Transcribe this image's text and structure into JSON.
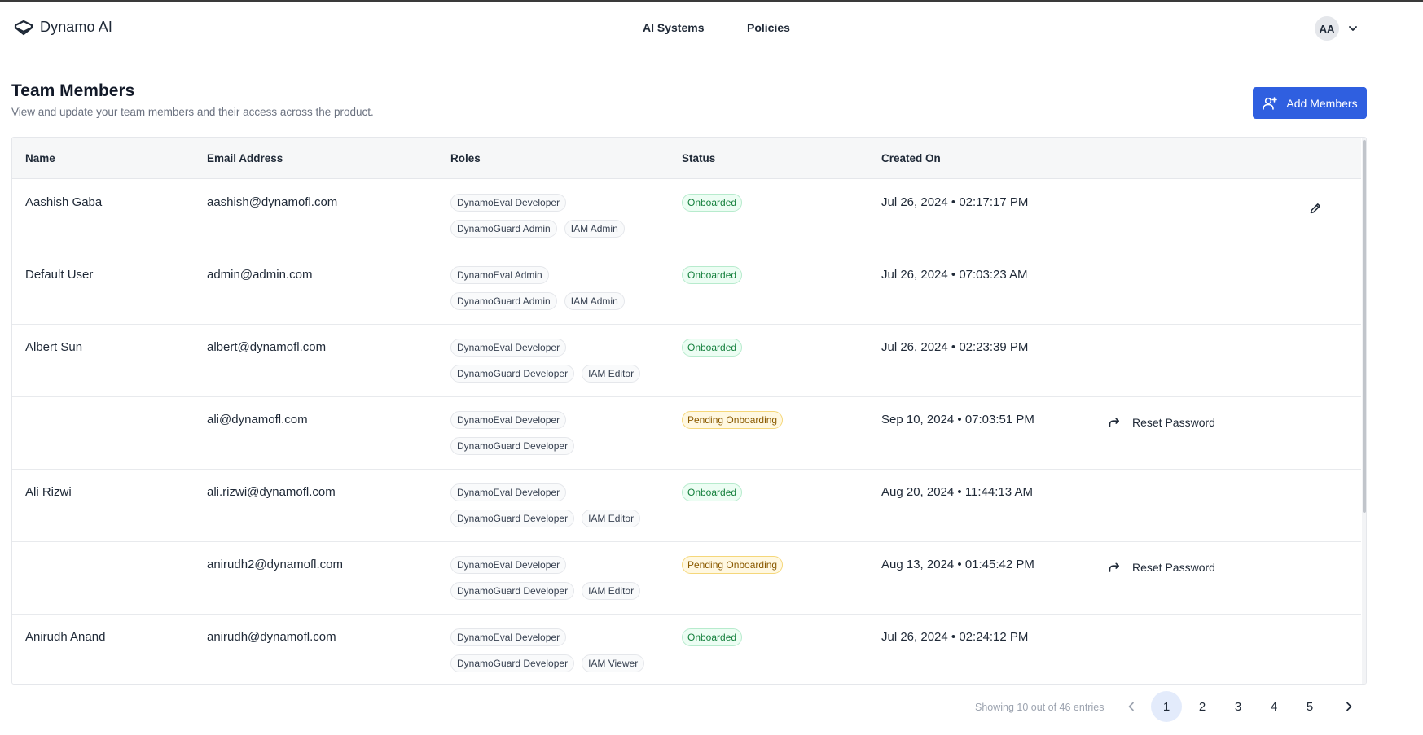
{
  "header": {
    "logo_text": "Dynamo AI",
    "nav": [
      {
        "label": "AI Systems"
      },
      {
        "label": "Policies"
      }
    ],
    "avatar_initials": "AA"
  },
  "page": {
    "title": "Team Members",
    "subtitle": "View and update your team members and their access across the product.",
    "add_button_label": "Add Members"
  },
  "table": {
    "columns": [
      "Name",
      "Email Address",
      "Roles",
      "Status",
      "Created On"
    ],
    "rows": [
      {
        "name": "Aashish Gaba",
        "email": "aashish@dynamofl.com",
        "roles": [
          [
            "DynamoEval Developer"
          ],
          [
            "DynamoGuard Admin",
            "IAM Admin"
          ]
        ],
        "status": "Onboarded",
        "created": "Jul 26, 2024 • 02:17:17 PM",
        "action": "edit-icon"
      },
      {
        "name": "Default User",
        "email": "admin@admin.com",
        "roles": [
          [
            "DynamoEval Admin"
          ],
          [
            "DynamoGuard Admin",
            "IAM Admin"
          ]
        ],
        "status": "Onboarded",
        "created": "Jul 26, 2024 • 07:03:23 AM",
        "action": ""
      },
      {
        "name": "Albert Sun",
        "email": "albert@dynamofl.com",
        "roles": [
          [
            "DynamoEval Developer"
          ],
          [
            "DynamoGuard Developer",
            "IAM Editor"
          ]
        ],
        "status": "Onboarded",
        "created": "Jul 26, 2024 • 02:23:39 PM",
        "action": ""
      },
      {
        "name": "",
        "email": "ali@dynamofl.com",
        "roles": [
          [
            "DynamoEval Developer"
          ],
          [
            "DynamoGuard Developer"
          ]
        ],
        "status": "Pending Onboarding",
        "created": "Sep 10, 2024 • 07:03:51 PM",
        "action": "Reset Password"
      },
      {
        "name": "Ali Rizwi",
        "email": "ali.rizwi@dynamofl.com",
        "roles": [
          [
            "DynamoEval Developer"
          ],
          [
            "DynamoGuard Developer",
            "IAM Editor"
          ]
        ],
        "status": "Onboarded",
        "created": "Aug 20, 2024 • 11:44:13 AM",
        "action": ""
      },
      {
        "name": "",
        "email": "anirudh2@dynamofl.com",
        "roles": [
          [
            "DynamoEval Developer"
          ],
          [
            "DynamoGuard Developer",
            "IAM Editor"
          ]
        ],
        "status": "Pending Onboarding",
        "created": "Aug 13, 2024 • 01:45:42 PM",
        "action": "Reset Password"
      },
      {
        "name": "Anirudh Anand",
        "email": "anirudh@dynamofl.com",
        "roles": [
          [
            "DynamoEval Developer"
          ],
          [
            "DynamoGuard Developer",
            "IAM Viewer"
          ]
        ],
        "status": "Onboarded",
        "created": "Jul 26, 2024 • 02:24:12 PM",
        "action": ""
      }
    ]
  },
  "pagination": {
    "summary": "Showing 10 out of 46 entries",
    "pages": [
      "1",
      "2",
      "3",
      "4",
      "5"
    ],
    "current": "1"
  },
  "colors": {
    "accent": "#2f5fe0",
    "onboarded_bg": "#ecfdf3",
    "pending_bg": "#fff8e1"
  }
}
